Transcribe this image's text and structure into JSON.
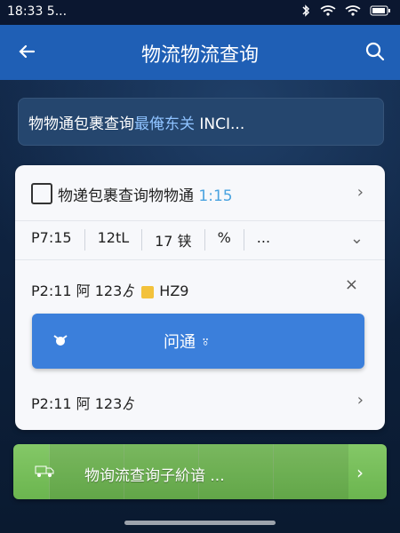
{
  "status_bar": {
    "time": "18:33 5...",
    "icons": [
      "bluetooth-icon",
      "wifi-icon",
      "signal-icon",
      "battery-icon"
    ]
  },
  "app_bar": {
    "title": "物流物流查询"
  },
  "search": {
    "text_prefix": "物物通包裹查询",
    "text_highlight": "最俺东关",
    "text_suffix": " INCI..."
  },
  "card": {
    "row1": {
      "label": "物递包裹查询物物通 ",
      "num": "1:15"
    },
    "row2": {
      "cells": [
        "P7:15",
        "12tL",
        "17 铗",
        "%",
        "..."
      ]
    },
    "row3": {
      "label_a": "P2:11 阿 123ゟ",
      "label_b": "HZ9",
      "dismiss": "×"
    },
    "row4": {
      "label": "P2:11 阿 123ゟ"
    }
  },
  "blue_button": {
    "label": "问通 ⍤"
  },
  "green_button": {
    "label": "物询流查询子紒谙 ..."
  },
  "colors": {
    "appbar": "#1f5fb5",
    "button_blue": "#3b7fdb",
    "green": "#6bb54f"
  }
}
